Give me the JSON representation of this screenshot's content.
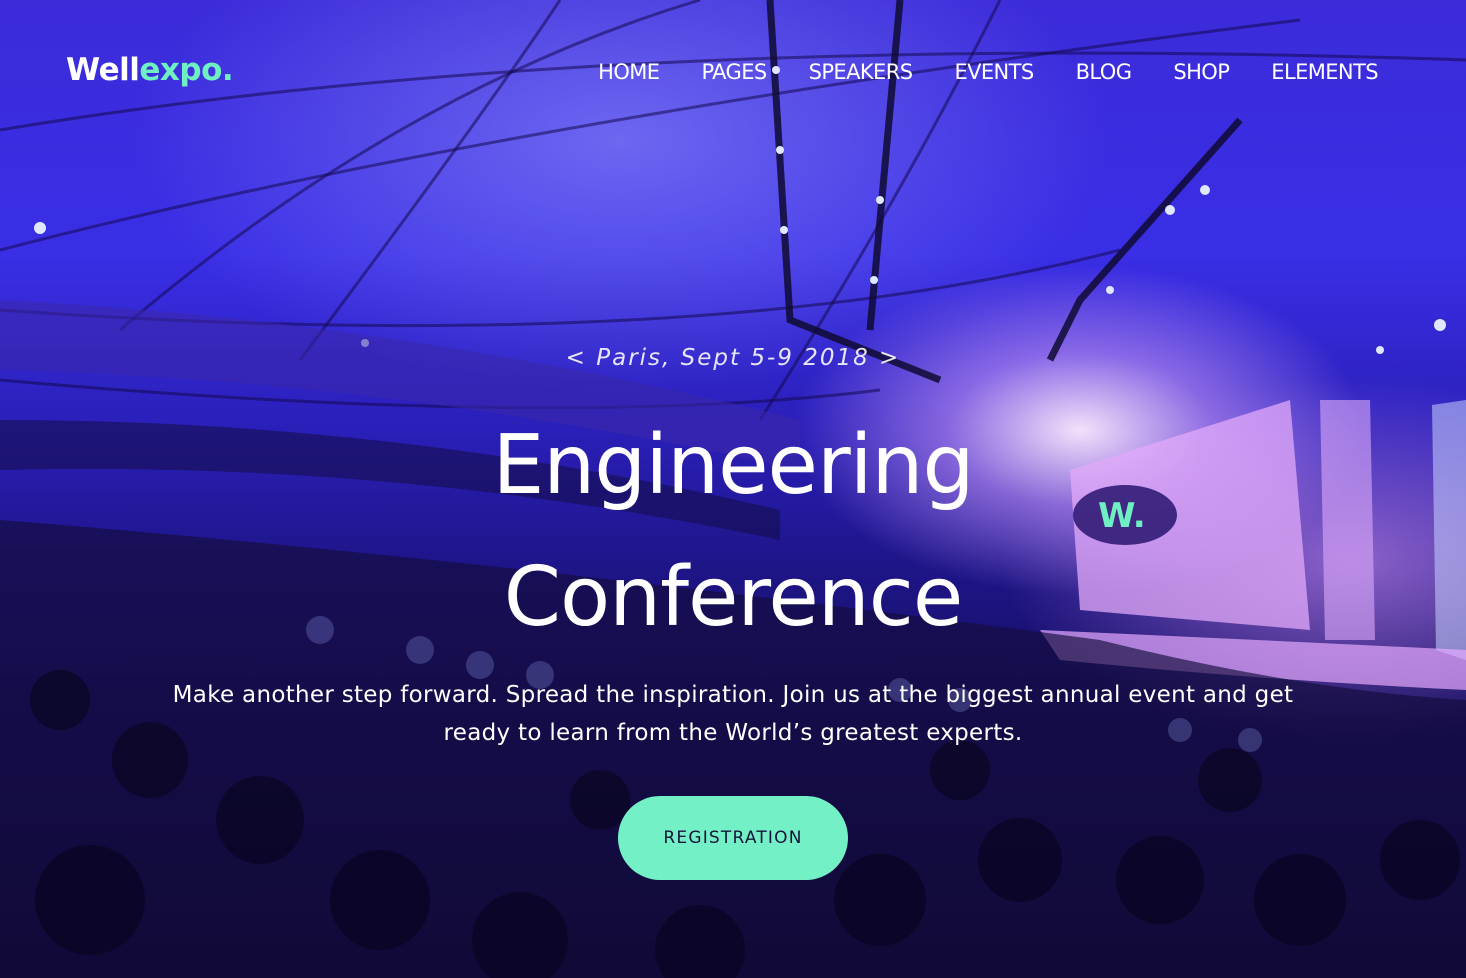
{
  "header": {
    "logo_main": "Well",
    "logo_accent": "expo.",
    "nav": [
      "HOME",
      "PAGES",
      "SPEAKERS",
      "EVENTS",
      "BLOG",
      "SHOP",
      "ELEMENTS"
    ]
  },
  "hero": {
    "date": "< Paris, Sept 5-9 2018 >",
    "title_line1": "Engineering",
    "title_line2": "Conference",
    "subtitle_line1": "Make another step forward. Spread the inspiration. Join us at the biggest annual event and get",
    "subtitle_line2": "ready to learn from the World’s greatest experts.",
    "cta_label": "REGISTRATION",
    "stage_logo": "W."
  },
  "colors": {
    "accent": "#6ff0c2",
    "button": "#74f0c6",
    "button_text": "#14143a",
    "background_blue": "#3a2ee6"
  }
}
